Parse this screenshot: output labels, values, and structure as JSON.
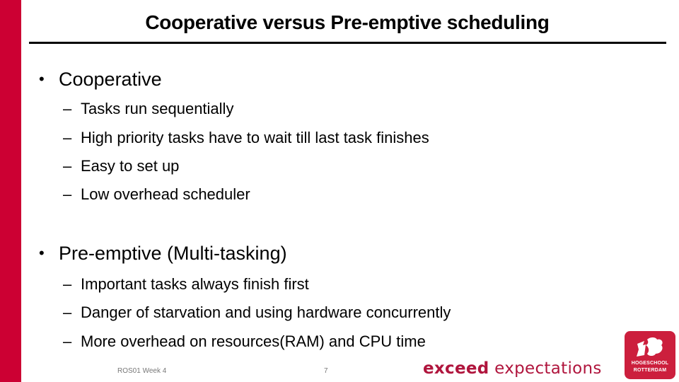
{
  "slide": {
    "title": "Cooperative versus Pre-emptive scheduling",
    "sections": [
      {
        "bullet": "•",
        "heading": "Cooperative",
        "items": [
          "Tasks run sequentially",
          "High priority tasks have to wait till last task finishes",
          "Easy to set up",
          "Low overhead scheduler"
        ]
      },
      {
        "bullet": "•",
        "heading": "Pre-emptive (Multi-tasking)",
        "items": [
          "Important tasks always finish first",
          "Danger of starvation and using hardware concurrently",
          "More overhead on resources(RAM) and CPU time"
        ]
      }
    ],
    "dash": "–"
  },
  "footer": {
    "course": "ROS01 Week 4",
    "page_number": "7",
    "slogan_bold": "exceed",
    "slogan_rest": "expectations",
    "logo_line1": "HOGESCHOOL",
    "logo_line2": "ROTTERDAM"
  },
  "colors": {
    "accent_red": "#cc0033",
    "slogan": "#b0153d"
  }
}
